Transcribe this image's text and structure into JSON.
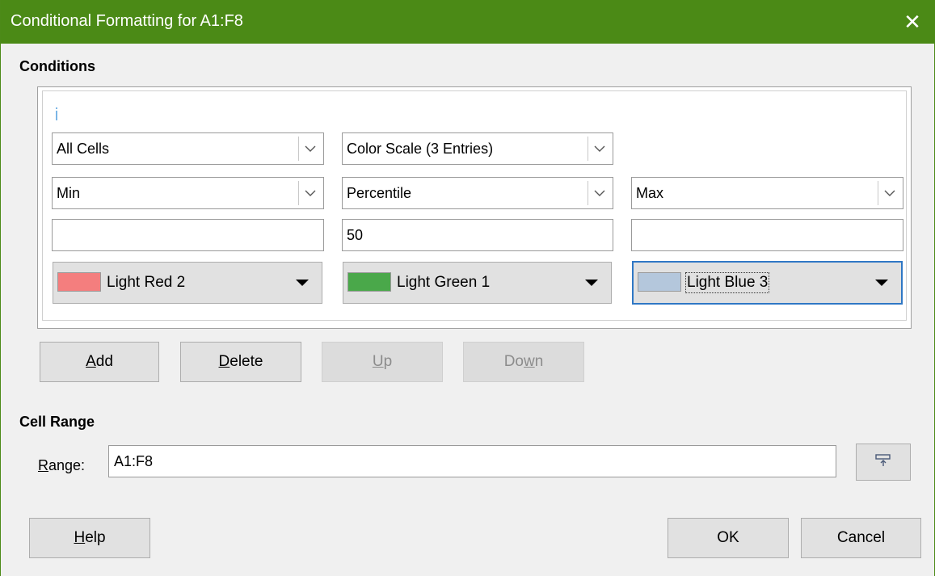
{
  "window": {
    "title": "Conditional Formatting for A1:F8",
    "close_glyph": "✕"
  },
  "conditions": {
    "heading": "Conditions",
    "apply_to": "All Cells",
    "format_type": "Color Scale (3 Entries)",
    "entries": [
      {
        "type": "Min",
        "value": "",
        "color_name": "Light Red 2",
        "color": "#f47e7e",
        "focused": false
      },
      {
        "type": "Percentile",
        "value": "50",
        "color_name": "Light Green 1",
        "color": "#4aa84a",
        "focused": false
      },
      {
        "type": "Max",
        "value": "",
        "color_name": "Light Blue 3",
        "color": "#b4c7dc",
        "focused": true
      }
    ]
  },
  "buttons": {
    "add": {
      "mnemonic": "A",
      "rest": "dd"
    },
    "delete": {
      "mnemonic": "D",
      "rest": "elete"
    },
    "up": {
      "mnemonic": "U",
      "rest": "p",
      "enabled": false
    },
    "down": {
      "pre": "Do",
      "mnemonic": "w",
      "rest": "n",
      "enabled": false
    }
  },
  "cell_range": {
    "heading": "Cell Range",
    "label_mnemonic": "R",
    "label_rest": "ange:",
    "value": "A1:F8",
    "shrink_icon": "shrink-icon"
  },
  "footer": {
    "help": {
      "mnemonic": "H",
      "rest": "elp"
    },
    "ok": "OK",
    "cancel": "Cancel"
  }
}
